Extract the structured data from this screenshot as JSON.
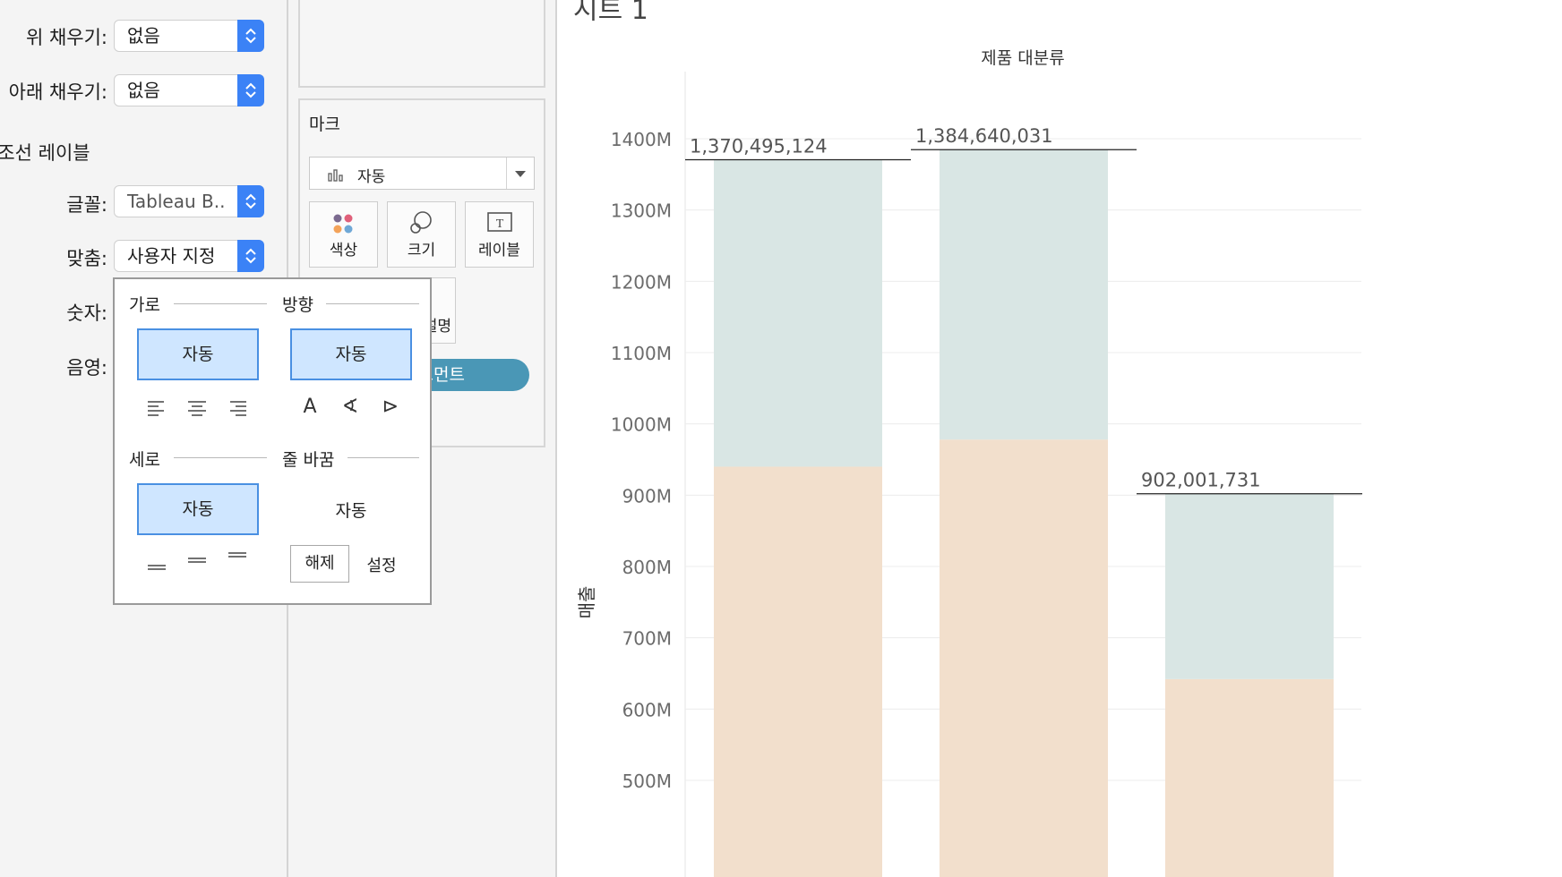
{
  "left_panel": {
    "top_fill_label": "위 채우기:",
    "top_fill_value": "없음",
    "bottom_fill_label": "아래 채우기:",
    "bottom_fill_value": "없음",
    "section_title": "참조선 레이블",
    "font_label": "글꼴:",
    "font_value": "Tableau B..",
    "align_label": "맞춤:",
    "align_value": "사용자 지정",
    "number_label": "숫자:",
    "shade_label": "음영:"
  },
  "marks_card": {
    "title": "마크",
    "mark_type": "자동",
    "buttons": [
      {
        "label": "색상",
        "icon": "color-dots-icon"
      },
      {
        "label": "크기",
        "icon": "size-circles-icon"
      },
      {
        "label": "레이블",
        "icon": "text-label-icon"
      }
    ],
    "tooltip_partial": "설명",
    "pill_partial": "그먼트"
  },
  "alignment_popover": {
    "horizontal_title": "가로",
    "direction_title": "방향",
    "vertical_title": "세로",
    "wrap_title": "줄 바꿈",
    "horizontal_auto": "자동",
    "direction_auto": "자동",
    "vertical_auto": "자동",
    "wrap_auto": "자동",
    "wrap_off": "해제",
    "wrap_on": "설정",
    "direction_glyphs": [
      "A",
      "∢",
      "⊳"
    ]
  },
  "chart_data": {
    "type": "bar",
    "sheet_title": "시트 1",
    "column_header": "제품 대분류",
    "ylabel": "매출",
    "ylim": [
      500,
      1450
    ],
    "y_unit": "M",
    "yticks": [
      "500M",
      "600M",
      "700M",
      "800M",
      "900M",
      "1000M",
      "1100M",
      "1200M",
      "1300M",
      "1400M"
    ],
    "grid": true,
    "categories": [
      "",
      "",
      ""
    ],
    "series": [
      {
        "color": "#f2dfcc",
        "values": [
          940,
          978,
          642
        ]
      },
      {
        "color": "#d9e6e4",
        "values": [
          430.5,
          406.6,
          260
        ]
      }
    ],
    "totals": [
      1370.495124,
      1384.640031,
      902.001731
    ],
    "reference_labels": [
      "1,370,495,124",
      "1,384,640,031",
      "902,001,731"
    ]
  }
}
